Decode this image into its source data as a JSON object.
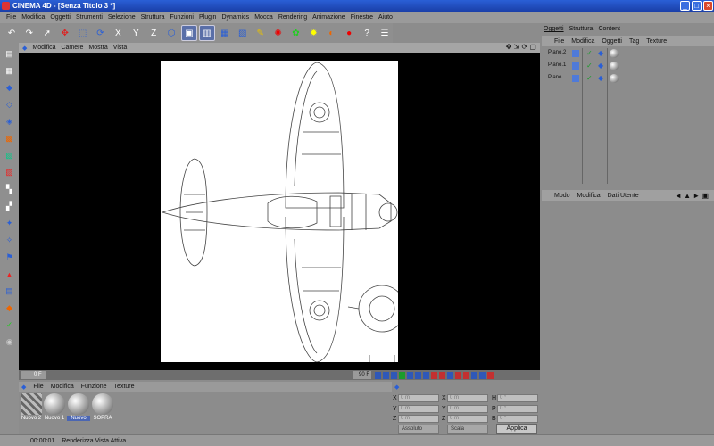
{
  "window": {
    "title": "CINEMA 4D - [Senza Titolo 3 *]",
    "minimize_icon": "minimize-icon",
    "maximize_icon": "maximize-icon",
    "close_icon": "close-icon"
  },
  "menubar": [
    "File",
    "Modifica",
    "Oggetti",
    "Strumenti",
    "Selezione",
    "Struttura",
    "Funzioni",
    "Plugin",
    "Dynamics",
    "Mocca",
    "Rendering",
    "Animazione",
    "Finestre",
    "Aiuto"
  ],
  "viewport": {
    "menu": [
      "Modifica",
      "Camere",
      "Mostra",
      "Vista"
    ]
  },
  "timeline": {
    "start": "0 F",
    "end": "90 F"
  },
  "materials": {
    "menu": [
      "File",
      "Modifica",
      "Funzione",
      "Texture"
    ],
    "items": [
      {
        "label": "Nuovo 2",
        "selected": false,
        "striped": true
      },
      {
        "label": "Nuovo 1",
        "selected": false
      },
      {
        "label": "Nuovo",
        "selected": true
      },
      {
        "label": "SOPRA",
        "selected": false
      }
    ]
  },
  "coordinates": {
    "rows": [
      {
        "a": "X",
        "a_val": "0 m",
        "b": "X",
        "b_val": "0 m",
        "c": "H",
        "c_val": "0 °"
      },
      {
        "a": "Y",
        "a_val": "0 m",
        "b": "Y",
        "b_val": "0 m",
        "c": "P",
        "c_val": "0 °"
      },
      {
        "a": "Z",
        "a_val": "0 m",
        "b": "Z",
        "b_val": "0 m",
        "c": "B",
        "c_val": "0 °"
      }
    ],
    "mode": "Assoluto",
    "scale": "Scala",
    "apply": "Applica"
  },
  "statusbar": {
    "time": "00:00:01",
    "message": "Renderizza Vista Attiva"
  },
  "objects": {
    "tabs": [
      "Oggetti",
      "Struttura",
      "Content"
    ],
    "menu": [
      "File",
      "Modifica",
      "Oggetti",
      "Tag",
      "Texture"
    ],
    "items": [
      "Piano.2",
      "Piano.1",
      "Piano"
    ]
  },
  "attributes": {
    "menu": [
      "Modo",
      "Modifica",
      "Dati Utente"
    ]
  },
  "colors": {
    "titlebar": "#1a3fa8",
    "panel": "#8c8c8c",
    "selection": "#4b66b2"
  }
}
